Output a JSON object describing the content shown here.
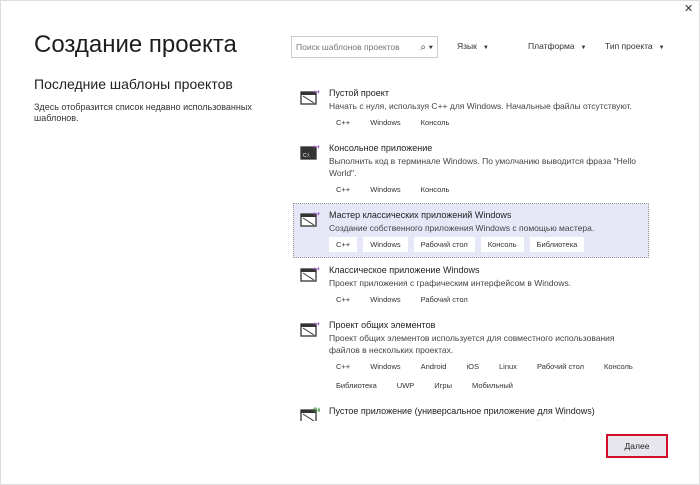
{
  "window": {
    "close": "✕"
  },
  "title": "Создание проекта",
  "recent": {
    "heading": "Последние шаблоны проектов",
    "description": "Здесь отобразится список недавно использованных шаблонов."
  },
  "search": {
    "placeholder": "Поиск шаблонов проектов",
    "icon": "⌕ ▾"
  },
  "filters": [
    {
      "label": "Язык"
    },
    {
      "label": "Платформа"
    },
    {
      "label": "Тип проекта"
    }
  ],
  "templates": [
    {
      "title": "Пустой проект",
      "desc": "Начать с нуля, используя C++ для Windows. Начальные файлы отсутствуют.",
      "tags": [
        "C++",
        "Windows",
        "Консоль"
      ],
      "badge": "++",
      "icon": "empty-project-icon",
      "selected": false
    },
    {
      "title": "Консольное приложение",
      "desc": "Выполнить код в терминале Windows. По умолчанию выводится фраза \"Hello World\".",
      "tags": [
        "C++",
        "Windows",
        "Консоль"
      ],
      "badge": "++",
      "icon": "console-app-icon",
      "selected": false
    },
    {
      "title": "Мастер классических приложений Windows",
      "desc": "Создание собственного приложения Windows с помощью мастера.",
      "tags": [
        "C++",
        "Windows",
        "Рабочий стол",
        "Консоль",
        "Библиотека"
      ],
      "badge": "++",
      "icon": "wizard-icon",
      "selected": true
    },
    {
      "title": "Классическое приложение Windows",
      "desc": "Проект приложения с графическим интерфейсом в Windows.",
      "tags": [
        "C++",
        "Windows",
        "Рабочий стол"
      ],
      "badge": "++",
      "icon": "desktop-app-icon",
      "selected": false
    },
    {
      "title": "Проект общих элементов",
      "desc": "Проект общих элементов используется для совместного использования файлов в нескольких проектах.",
      "tags": [
        "C++",
        "Windows",
        "Android",
        "iOS",
        "Linux",
        "Рабочий стол",
        "Консоль",
        "Библиотека",
        "UWP",
        "Игры",
        "Мобильный"
      ],
      "badge": "++",
      "icon": "shared-items-icon",
      "selected": false
    },
    {
      "title": "Пустое приложение (универсальное приложение для Windows)",
      "desc": "Проект одностраничного приложения универсальной платформы Windows",
      "tags": [],
      "badge": "C#",
      "icon": "uwp-app-icon",
      "selected": false
    }
  ],
  "next_label": "Далее"
}
